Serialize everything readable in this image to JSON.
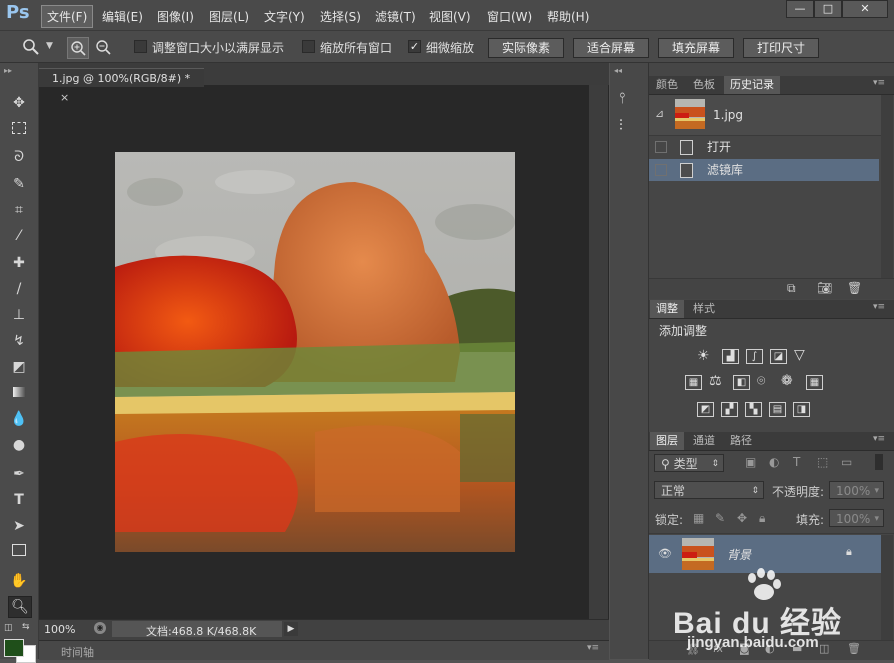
{
  "app": {
    "logo": "Ps"
  },
  "menubar": {
    "items": [
      "文件(F)",
      "编辑(E)",
      "图像(I)",
      "图层(L)",
      "文字(Y)",
      "选择(S)",
      "滤镜(T)",
      "视图(V)",
      "窗口(W)",
      "帮助(H)"
    ],
    "active_index": 0,
    "window_controls": {
      "minimize": "—",
      "restore": "□",
      "close": "✕"
    }
  },
  "options": {
    "tool_icon": "zoom-icon",
    "resize_windows_label": "调整窗口大小以满屏显示",
    "resize_windows_checked": false,
    "zoom_all_label": "缩放所有窗口",
    "zoom_all_checked": false,
    "scrubby_label": "细微缩放",
    "scrubby_checked": true,
    "buttons": {
      "actual_pixels": "实际像素",
      "fit_screen": "适合屏幕",
      "fill_screen": "填充屏幕",
      "print_size": "打印尺寸"
    }
  },
  "document": {
    "tab_title": "1.jpg @ 100%(RGB/8#) *",
    "tab_close": "×",
    "zoom": "100%",
    "doc_info": "文档:468.8 K/468.8K",
    "timeline_label": "时间轴"
  },
  "history_panel": {
    "tabs": [
      "颜色",
      "色板",
      "历史记录"
    ],
    "active_tab": 2,
    "snapshot_name": "1.jpg",
    "states": [
      "打开",
      "滤镜库"
    ],
    "selected_state": 1
  },
  "adjustments_panel": {
    "tabs": [
      "调整",
      "样式"
    ],
    "active_tab": 0,
    "title": "添加调整"
  },
  "layers_panel": {
    "tabs": [
      "图层",
      "通道",
      "路径"
    ],
    "active_tab": 0,
    "filter_kind": "类型",
    "blend_mode": "正常",
    "opacity_label": "不透明度:",
    "opacity_value": "100%",
    "lock_label": "锁定:",
    "fill_label": "填充:",
    "fill_value": "100%",
    "layers": [
      {
        "name": "背景",
        "visible": true,
        "locked": true
      }
    ]
  },
  "colors": {
    "foreground": "#1f4f1a",
    "background": "#ffffff",
    "selection_blue": "#5b6d83"
  },
  "watermark": {
    "brand": "Bai du 经验",
    "url": "jingyan.baidu.com"
  }
}
